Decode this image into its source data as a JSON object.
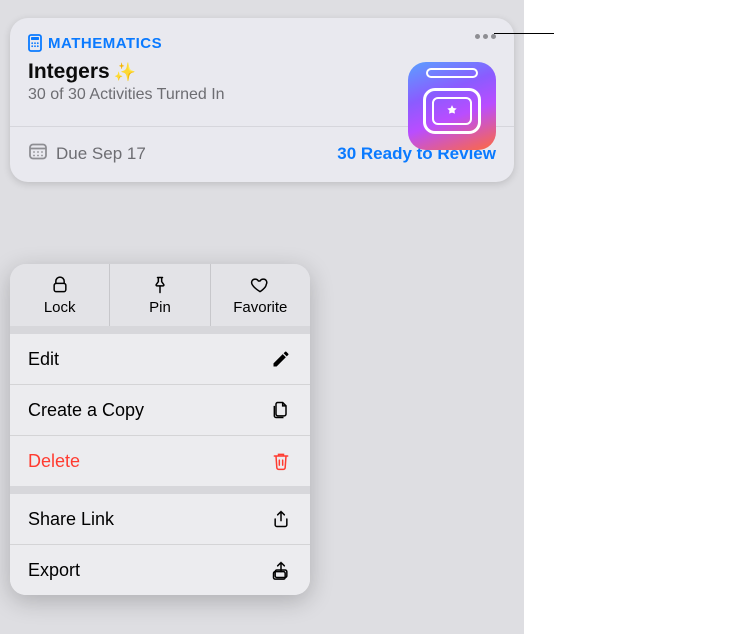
{
  "card": {
    "subject": "MATHEMATICS",
    "title": "Integers",
    "sparkle": "✨",
    "subtitle": "30 of 30 Activities Turned In",
    "due_label": "Due Sep 17",
    "review_label": "30 Ready to Review"
  },
  "menu": {
    "top": {
      "lock": "Lock",
      "pin": "Pin",
      "favorite": "Favorite"
    },
    "edit": "Edit",
    "copy": "Create a Copy",
    "delete": "Delete",
    "share": "Share Link",
    "export": "Export"
  },
  "colors": {
    "accent": "#0a7aff",
    "danger": "#ff3b30"
  }
}
